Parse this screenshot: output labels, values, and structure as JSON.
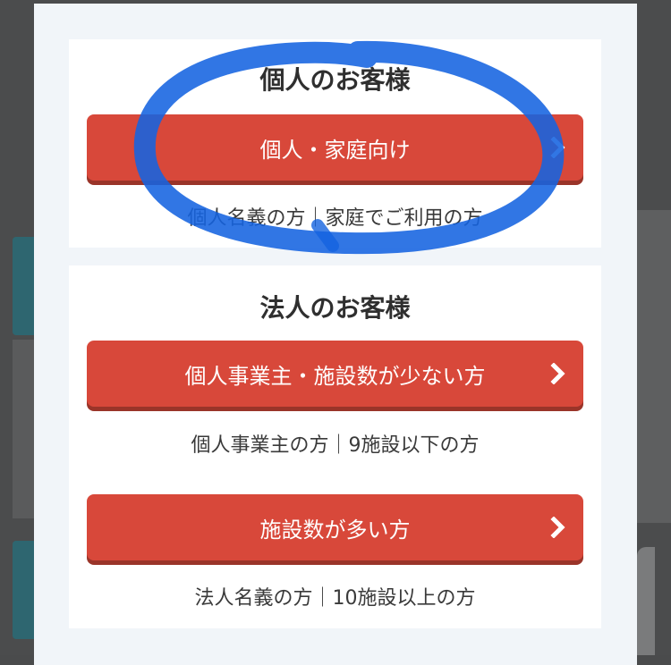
{
  "personal": {
    "title": "個人のお客様",
    "button_label": "個人・家庭向け",
    "caption": "個人名義の方｜家庭でご利用の方"
  },
  "corporate": {
    "title": "法人のお客様",
    "buttons": [
      {
        "label": "個人事業主・施設数が少ない方",
        "caption": "個人事業主の方｜9施設以下の方"
      },
      {
        "label": "施設数が多い方",
        "caption": "法人名義の方｜10施設以上の方"
      }
    ]
  },
  "icons": {
    "button_arrow": "chevron-right-icon",
    "annotation": "hand-drawn-circle"
  },
  "colors": {
    "button": "#d8483a",
    "button_shadow": "#9a3429",
    "annotation": "#1463e0",
    "modal_bg": "#f1f5f9"
  }
}
